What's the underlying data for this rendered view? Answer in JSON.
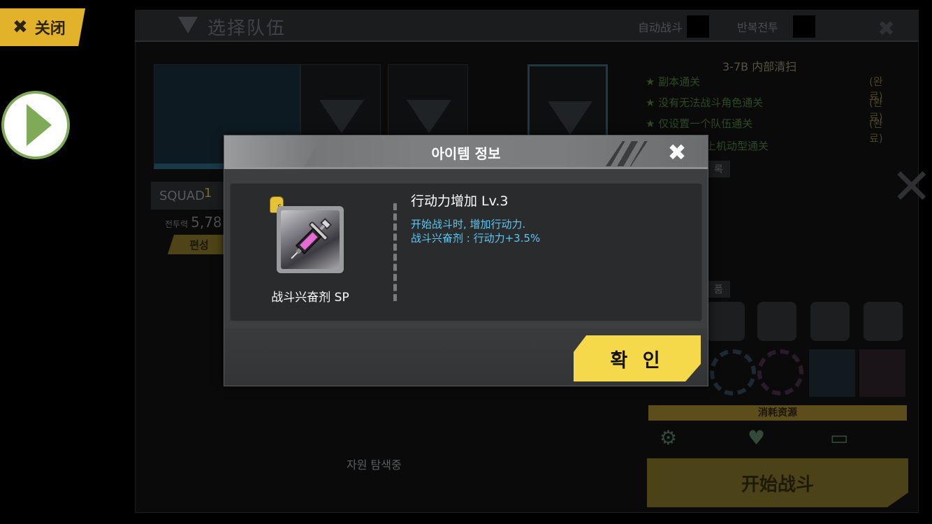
{
  "top": {
    "close_label": "关闭"
  },
  "panel": {
    "title": "选择队伍",
    "auto_battle": "自动战斗",
    "repeat_battle": "반복전투"
  },
  "squad": {
    "label": "SQUAD",
    "number": "1",
    "power_label": "전투력",
    "power_value": "5,78",
    "edit_label": "편성"
  },
  "search": {
    "searching_1": "자원 탐색중",
    "searching_2": "자원 탐색중"
  },
  "stage": {
    "name": "3-7B 内部清扫",
    "goals": [
      {
        "text": "★ 副本通关",
        "status": "(완료)"
      },
      {
        "text": "★ 没有无法战斗角色通关",
        "status": "(완료)"
      },
      {
        "text": "★ 仅设置一个队伍通关",
        "status": "(완료)"
      },
      {
        "text": "上机动型通关",
        "status": ""
      }
    ],
    "label_record": "록",
    "label_items": "품",
    "consume_label": "消耗资源",
    "start_label": "开始战斗"
  },
  "dialog": {
    "title": "아이템 정보",
    "item_name": "战斗兴奋剂 SP",
    "badge": "S",
    "skill_title": "行动力增加 Lv.3",
    "skill_desc_1": "开始战斗时, 增加行动力.",
    "skill_desc_2": "战斗兴奋剂 : 行动力+3.5%",
    "confirm_label": "확 인"
  },
  "icons": {
    "close": "close-icon",
    "play": "play-icon",
    "filter": "filter-icon",
    "dialog_close": "close-icon",
    "item": "syringe-icon"
  },
  "colors": {
    "accent_yellow": "#f6d94a",
    "skill_text": "#5ec8f2",
    "play_green": "#7faa57",
    "tab_yellow": "#e1b22a"
  }
}
